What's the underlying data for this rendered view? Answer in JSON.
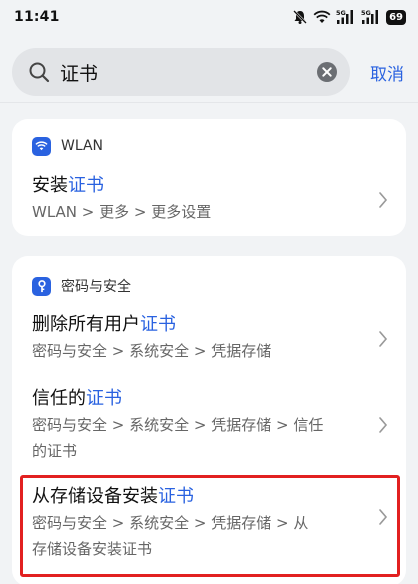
{
  "status_bar": {
    "time": "11:41",
    "battery": "69",
    "signal_1_label": "5G",
    "signal_2_label": "5G",
    "icons": [
      "mute-icon",
      "wifi-icon",
      "signal-icon",
      "signal-icon",
      "battery-icon"
    ]
  },
  "search": {
    "value": "证书",
    "cancel_label": "取消",
    "icons": [
      "search-icon",
      "clear-icon"
    ]
  },
  "colors": {
    "accent": "#2a62e0",
    "highlight_frame": "#e22020"
  },
  "sections": [
    {
      "title": "WLAN",
      "icon": "wifi-icon",
      "results": [
        {
          "title_pre": "安装",
          "title_hl": "证书",
          "path": "WLAN > 更多 > 更多设置"
        }
      ]
    },
    {
      "title": "密码与安全",
      "icon": "key-icon",
      "results": [
        {
          "title_pre": "删除所有用户",
          "title_hl": "证书",
          "path": "密码与安全 > 系统安全 > 凭据存储"
        },
        {
          "title_pre": "信任的",
          "title_hl": "证书",
          "path_line1": "密码与安全 > 系统安全 > 凭据存储 > 信任",
          "path_line2": "的证书"
        },
        {
          "title_pre": "从存储设备安装",
          "title_hl": "证书",
          "path_line1": "密码与安全 > 系统安全 > 凭据存储 > 从",
          "path_line2": "存储设备安装证书"
        }
      ]
    }
  ]
}
